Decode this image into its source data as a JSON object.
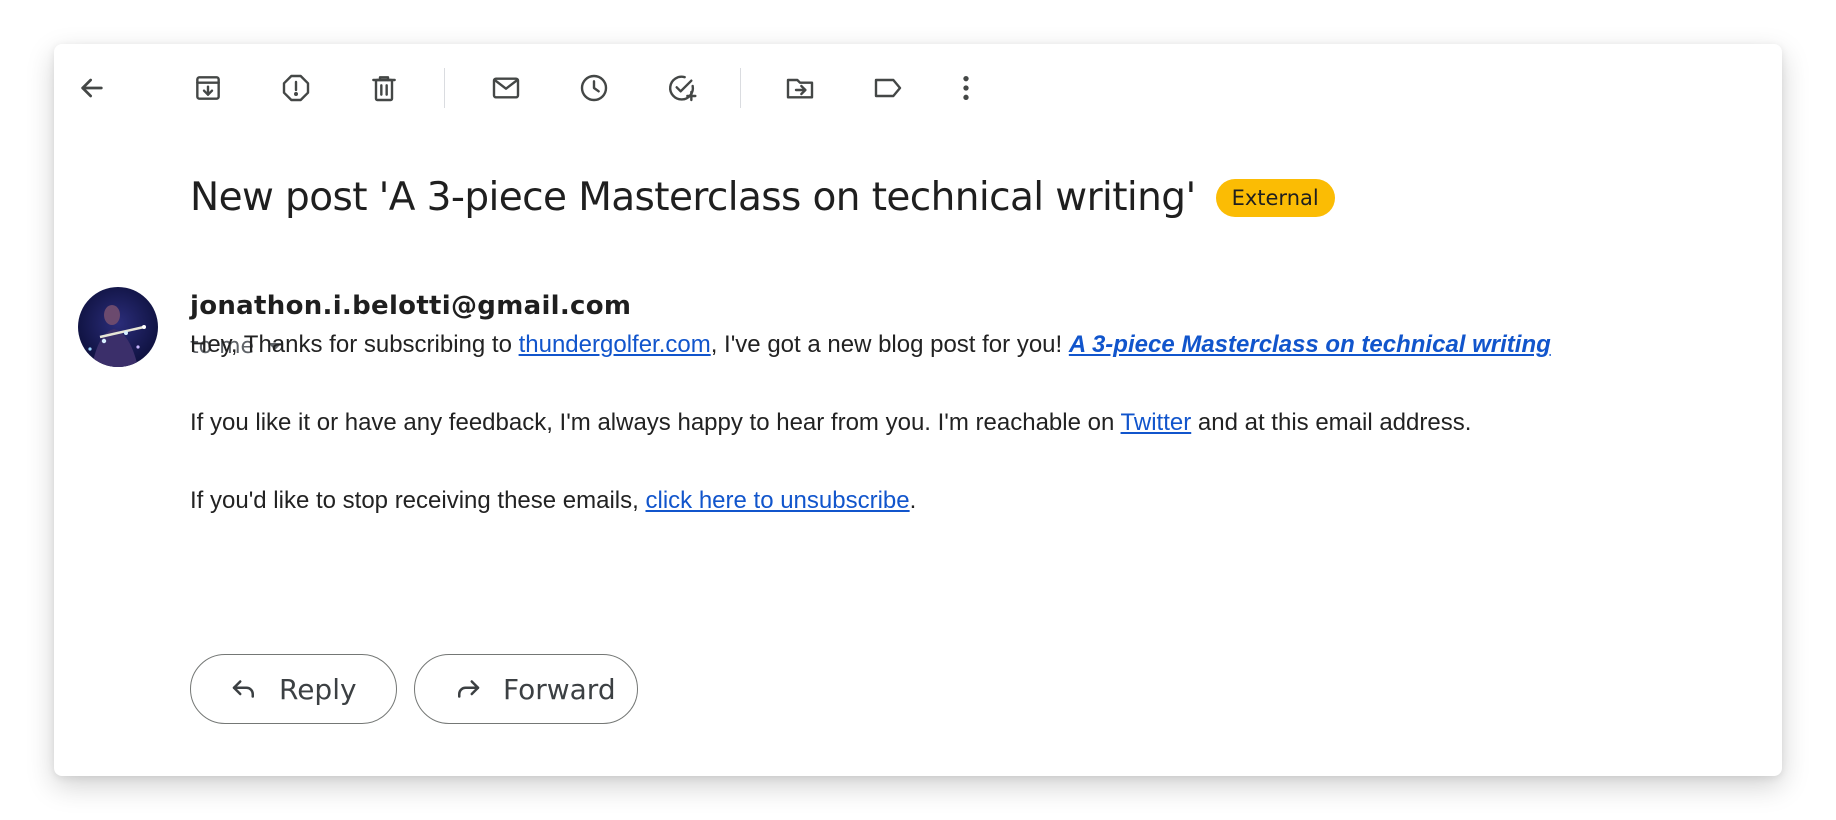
{
  "toolbar": {
    "icons": [
      "back-arrow-icon",
      "archive-icon",
      "report-spam-icon",
      "delete-icon",
      "mark-unread-icon",
      "snooze-icon",
      "add-to-tasks-icon",
      "move-to-icon",
      "label-icon",
      "more-options-icon"
    ]
  },
  "message": {
    "subject": "New post 'A 3-piece Masterclass on technical writing'",
    "badge": "External",
    "sender": "jonathon.i.belotti@gmail.com",
    "recipient_label": "to me",
    "body": {
      "p1_before": "Hey, Thanks for subscribing to ",
      "p1_link": "thundergolfer.com",
      "p1_middle": ", I've got a new blog post for you! ",
      "p1_post_link": "A 3-piece Masterclass on technical writing",
      "p2_before": "If you like it or have any feedback, I'm always happy to hear from you. I'm reachable on ",
      "p2_link": "Twitter",
      "p2_after": " and at this email address.",
      "p3_before": "If you'd like to stop receiving these emails, ",
      "p3_link": "click here to unsubscribe",
      "p3_after": "."
    }
  },
  "actions": {
    "reply_label": "Reply",
    "forward_label": "Forward"
  },
  "colors": {
    "badge": "#fbbc04",
    "link": "#1155cc",
    "icon": "#444746"
  }
}
